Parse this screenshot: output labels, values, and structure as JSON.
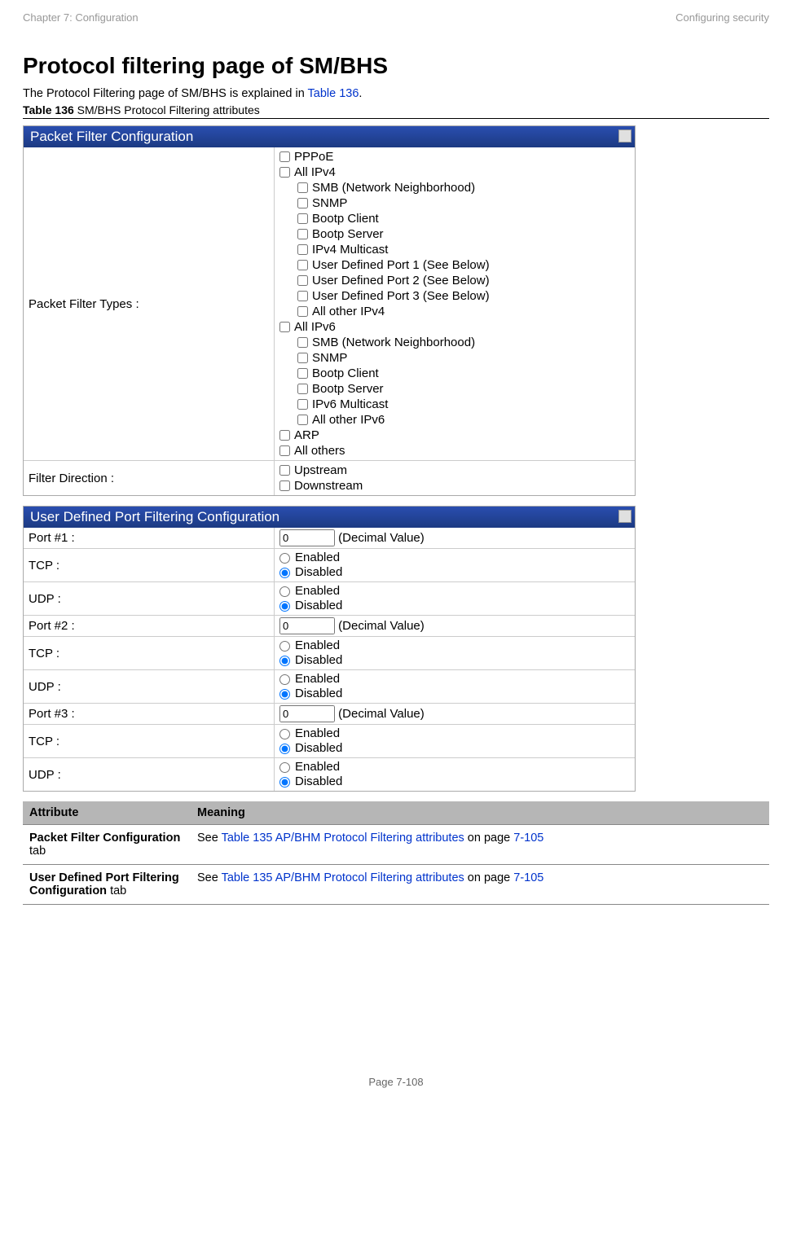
{
  "header": {
    "left": "Chapter 7:  Configuration",
    "right": "Configuring security"
  },
  "title": "Protocol filtering page of SM/BHS",
  "intro_pre": "The Protocol Filtering page of SM/BHS is explained in ",
  "intro_link": "Table 136",
  "intro_post": ".",
  "caption_pre": "Table 136",
  "caption_rest": " SM/BHS Protocol Filtering attributes",
  "panel1": {
    "title": "Packet Filter Configuration",
    "row1_label": "Packet Filter Types :",
    "row2_label": "Filter Direction :",
    "checks": {
      "pppoe": "PPPoE",
      "ipv4": "All IPv4",
      "smb4": "SMB (Network Neighborhood)",
      "snmp4": "SNMP",
      "bootpc4": "Bootp Client",
      "bootps4": "Bootp Server",
      "mcast4": "IPv4 Multicast",
      "udp1": "User Defined Port 1 (See Below)",
      "udp2": "User Defined Port 2 (See Below)",
      "udp3": "User Defined Port 3 (See Below)",
      "other4": "All other IPv4",
      "ipv6": "All IPv6",
      "smb6": "SMB (Network Neighborhood)",
      "snmp6": "SNMP",
      "bootpc6": "Bootp Client",
      "bootps6": "Bootp Server",
      "mcast6": "IPv6 Multicast",
      "other6": "All other IPv6",
      "arp": "ARP",
      "allothers": "All others",
      "upstream": "Upstream",
      "downstream": "Downstream"
    }
  },
  "panel2": {
    "title": "User Defined Port Filtering Configuration",
    "labels": {
      "port1": "Port #1 :",
      "port2": "Port #2 :",
      "port3": "Port #3 :",
      "tcp": "TCP :",
      "udp": "UDP :",
      "decimal": "(Decimal Value)",
      "enabled": "Enabled",
      "disabled": "Disabled",
      "port_value": "0"
    }
  },
  "attrtable": {
    "h1": "Attribute",
    "h2": "Meaning",
    "r1a_b1": "Packet Filter Configuration",
    "r1a_rest": " tab",
    "r1b_pre": "See ",
    "r1b_link": "Table 135 AP/BHM Protocol Filtering attributes",
    "r1b_mid": " on page ",
    "r1b_page": "7-105",
    "r2a_b1": "User Defined Port Filtering Configuration",
    "r2a_rest": " tab",
    "r2b_pre": "See ",
    "r2b_link": "Table 135 AP/BHM Protocol Filtering attributes",
    "r2b_mid": " on page ",
    "r2b_page": "7-105"
  },
  "footer": "Page 7-108"
}
